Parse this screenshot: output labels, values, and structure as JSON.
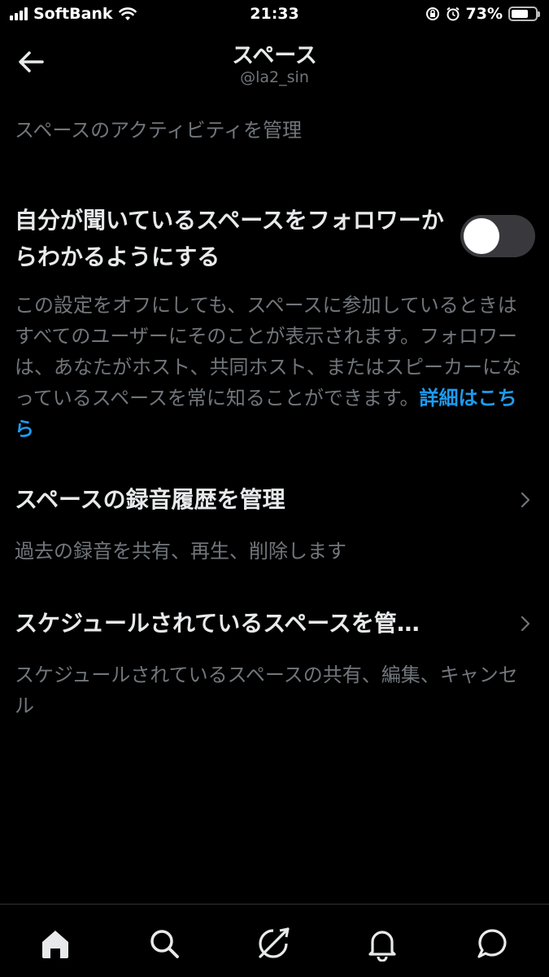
{
  "status_bar": {
    "carrier": "SoftBank",
    "time": "21:33",
    "battery": "73%",
    "battery_level": 0.73,
    "icons": [
      "signal-icon",
      "wifi-icon",
      "orientation-lock-icon",
      "alarm-icon",
      "battery-icon"
    ]
  },
  "header": {
    "title": "スペース",
    "handle": "@la2_sin",
    "back_icon": "back-arrow-icon"
  },
  "section_caption": "スペースのアクティビティを管理",
  "toggle_setting": {
    "title": "自分が聞いているスペースをフォロワーからわかるようにする",
    "enabled": false,
    "description": "この設定をオフにしても、スペースに参加しているときはすべてのユーザーにそのことが表示されます。フォロワーは、あなたがホスト、共同ホスト、またはスピーカーになっているスペースを常に知ることができます。",
    "link_text": "詳細はこちら"
  },
  "recordings": {
    "title": "スペースの録音履歴を管理",
    "subtitle": "過去の録音を共有、再生、削除します"
  },
  "scheduled": {
    "title": "スケジュールされているスペースを管…",
    "subtitle": "スケジュールされているスペースの共有、編集、キャンセル"
  },
  "tab_bar": {
    "tabs": [
      "home-icon",
      "search-icon",
      "spaces-icon",
      "notifications-icon",
      "messages-icon"
    ]
  },
  "colors": {
    "background": "#000000",
    "primary_text": "#e7e9ea",
    "secondary_text": "#71767b",
    "link": "#1d9bf0",
    "toggle_off": "#39393d"
  }
}
